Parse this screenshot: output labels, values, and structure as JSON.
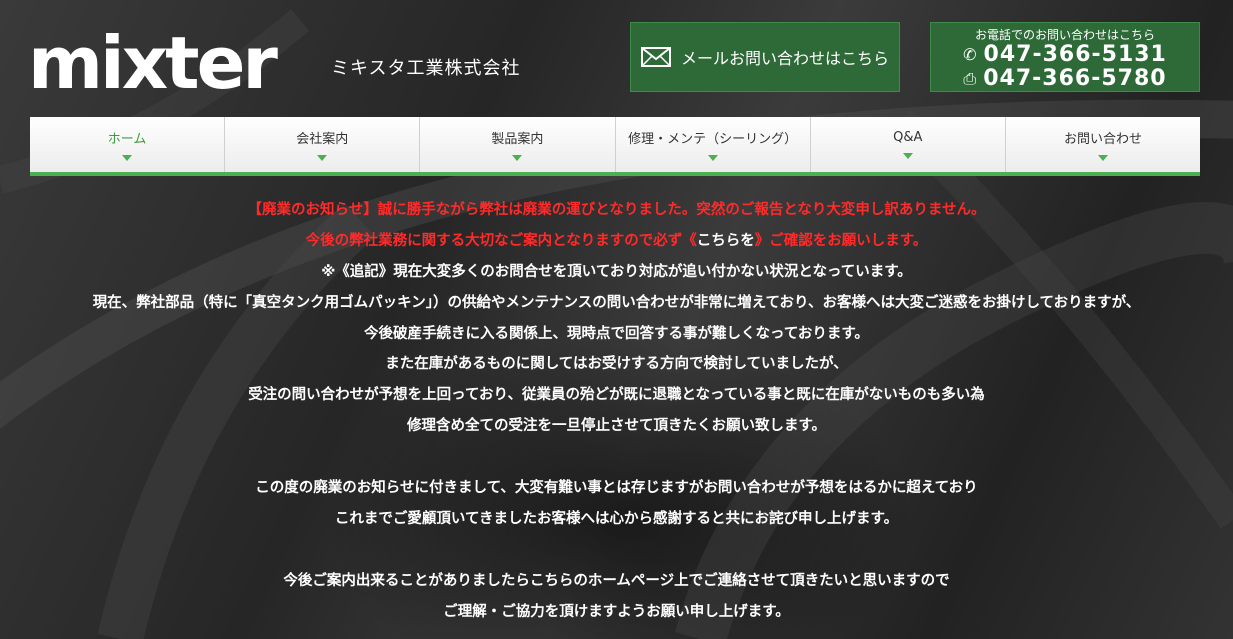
{
  "header": {
    "logo_text": "mixter",
    "company_name": "ミキスタ工業株式会社",
    "mail_button": {
      "label": "メールお問い合わせはこちら",
      "icon": "envelope-icon"
    },
    "tel_box": {
      "caption": "お電話でのお問い合わせはこちら",
      "tel": {
        "icon": "phone-icon",
        "number": "047-366-5131"
      },
      "fax": {
        "icon": "fax-icon",
        "number": "047-366-5780"
      }
    }
  },
  "nav": {
    "items": [
      {
        "label": "ホーム",
        "active": true
      },
      {
        "label": "会社案内"
      },
      {
        "label": "製品案内"
      },
      {
        "label": "修理・メンテ（シーリング）"
      },
      {
        "label": "Q&A"
      },
      {
        "label": "お問い合わせ"
      }
    ]
  },
  "notice": {
    "line1": "【廃業のお知らせ】誠に勝手ながら弊社は廃業の運びとなりました。突然のご報告となり大変申し訳ありません。",
    "line2_pre": "今後の弊社業務に関する大切なご案内となりますので必ず《",
    "line2_link": "こちらを",
    "line2_post": "》ご確認をお願いします。",
    "line3": "※《追記》現在大変多くのお問合せを頂いており対応が追い付かない状況となっています。",
    "line4": "現在、弊社部品（特に「真空タンク用ゴムパッキン」）の供給やメンテナンスの問い合わせが非常に増えており、お客様へは大変ご迷惑をお掛けしておりますが、",
    "line5": "今後破産手続きに入る関係上、現時点で回答する事が難しくなっております。",
    "line6": "また在庫があるものに関してはお受けする方向で検討していましたが、",
    "line7": "受注の問い合わせが予想を上回っており、従業員の殆どが既に退職となっている事と既に在庫がないものも多い為",
    "line8": "修理含め全ての受注を一旦停止させて頂きたくお願い致します。",
    "line9": "この度の廃業のお知らせに付きまして、大変有難い事とは存じますがお問い合わせが予想をはるかに超えており",
    "line10": "これまでご愛顧頂いてきましたお客様へは心から感謝すると共にお詫び申し上げます。",
    "line11": "今後ご案内出来ることがありましたらこちらのホームページ上でご連絡させて頂きたいと思いますので",
    "line12": "ご理解・ご協力を頂けますようお願い申し上げます。"
  },
  "colors": {
    "accent_green": "#2d6a37",
    "nav_active": "#3f9a3f",
    "notice_red": "#ff2a2a",
    "background": "#2b2b2b"
  }
}
